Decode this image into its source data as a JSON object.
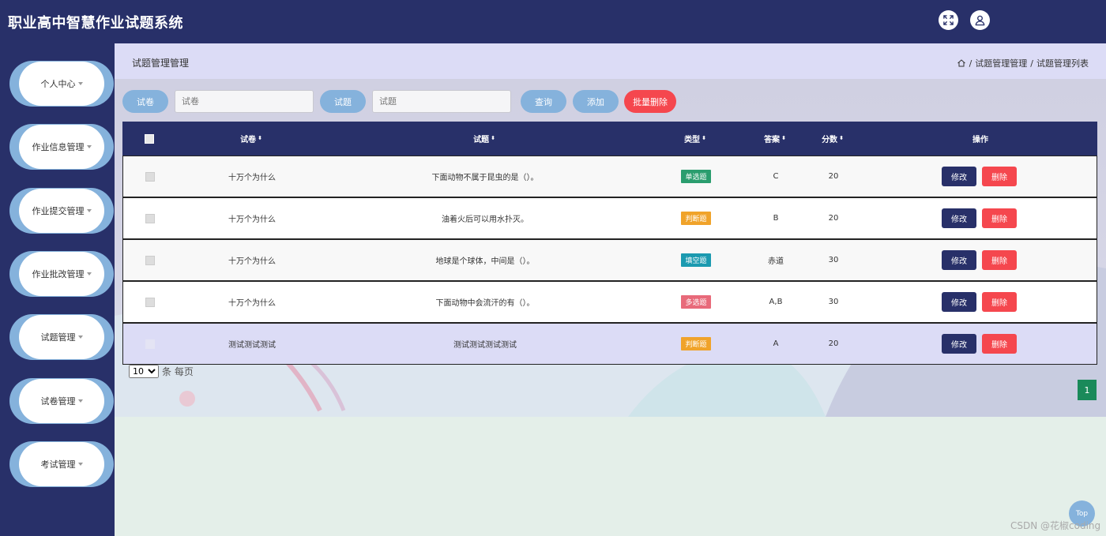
{
  "header": {
    "title": "职业高中智慧作业试题系统"
  },
  "sidebar": {
    "items": [
      {
        "label": "个人中心"
      },
      {
        "label": "作业信息管理"
      },
      {
        "label": "作业提交管理"
      },
      {
        "label": "作业批改管理"
      },
      {
        "label": "试题管理"
      },
      {
        "label": "试卷管理"
      },
      {
        "label": "考试管理"
      }
    ]
  },
  "page": {
    "title": "试题管理管理",
    "breadcrumb": [
      "试题管理管理",
      "试题管理列表"
    ]
  },
  "search": {
    "paper_label": "试卷",
    "paper_placeholder": "试卷",
    "question_label": "试题",
    "question_placeholder": "试题",
    "query_button": "查询",
    "add_button": "添加",
    "batch_delete_button": "批量删除"
  },
  "table": {
    "headers": {
      "paper": "试卷",
      "question": "试题",
      "type": "类型",
      "answer": "答案",
      "score": "分数",
      "actions": "操作"
    },
    "edit_label": "修改",
    "delete_label": "删除",
    "rows": [
      {
        "paper": "十万个为什么",
        "question": "下面动物不属于昆虫的是（）。",
        "type": "单选题",
        "answer": "C",
        "score": "20"
      },
      {
        "paper": "十万个为什么",
        "question": "油着火后可以用水扑灭。",
        "type": "判断题",
        "answer": "B",
        "score": "20"
      },
      {
        "paper": "十万个为什么",
        "question": "地球是个球体，中间是（）。",
        "type": "填空题",
        "answer": "赤道",
        "score": "30"
      },
      {
        "paper": "十万个为什么",
        "question": "下面动物中会流汗的有（）。",
        "type": "多选题",
        "answer": "A,B",
        "score": "30"
      },
      {
        "paper": "测试测试测试",
        "question": "测试测试测试测试",
        "type": "判断题",
        "answer": "A",
        "score": "20"
      }
    ]
  },
  "pagination": {
    "page_size": "10",
    "page_size_suffix": "条 每页",
    "current_page": "1"
  },
  "colors": {
    "primary": "#283069",
    "accent": "#85b2dc",
    "danger": "#f5474e",
    "single": "#2a9d6e",
    "judge": "#f0a32a",
    "fill": "#1b9ab0",
    "multi": "#e86a7a",
    "page": "#1a8a5a"
  },
  "back_to_top": "Top",
  "watermark": "CSDN @花椒coding"
}
